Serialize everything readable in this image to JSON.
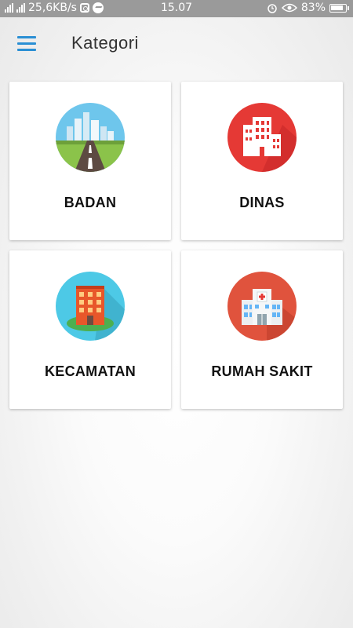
{
  "status_bar": {
    "network_speed": "25,6KB/s",
    "time": "15.07",
    "battery": "83%"
  },
  "header": {
    "title": "Kategori",
    "menu_icon": "hamburger-menu-icon"
  },
  "categories": [
    {
      "label": "BADAN",
      "icon": "city-road-icon",
      "color": "#6ec6ec"
    },
    {
      "label": "DINAS",
      "icon": "office-building-icon",
      "color": "#e53935"
    },
    {
      "label": "KECAMATAN",
      "icon": "apartment-building-icon",
      "color": "#4dc9e6"
    },
    {
      "label": "RUMAH SAKIT",
      "icon": "hospital-icon",
      "color": "#e0533d"
    }
  ],
  "colors": {
    "accent": "#2a8fd4",
    "status_bar": "#9a9a9a"
  }
}
